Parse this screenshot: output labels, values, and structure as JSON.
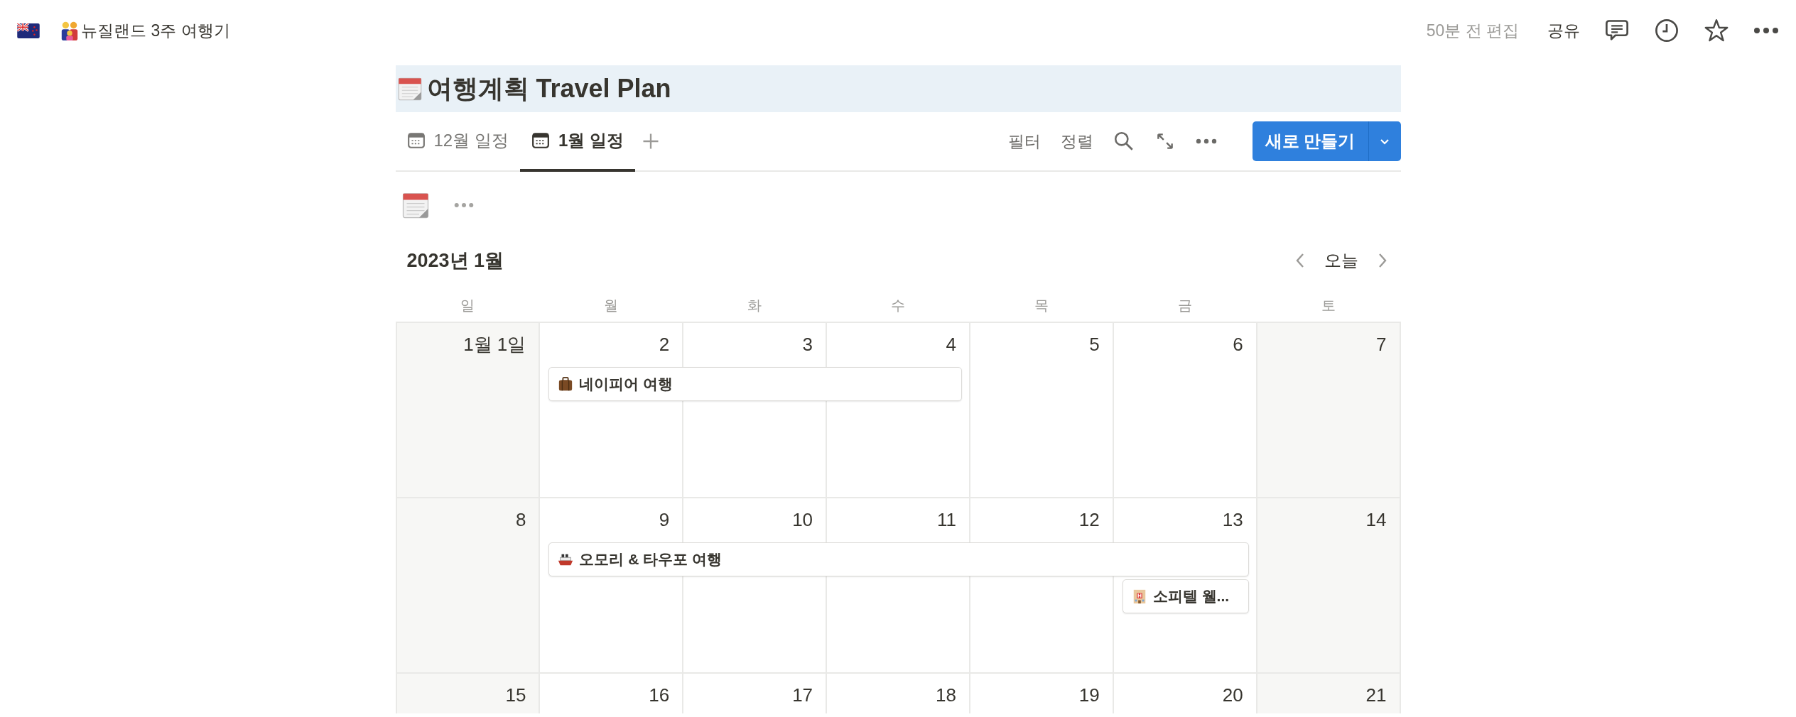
{
  "top_bar": {
    "breadcrumb": "뉴질랜드 3주 여행기",
    "edited": "50분 전 편집",
    "share": "공유"
  },
  "page": {
    "title": "여행계획 Travel Plan"
  },
  "tabs": [
    {
      "label": "12월 일정",
      "selected": false
    },
    {
      "label": "1월 일정",
      "selected": true
    }
  ],
  "toolbar": {
    "filter": "필터",
    "sort": "정렬",
    "new_button": "새로 만들기"
  },
  "calendar": {
    "month": "2023년 1월",
    "today": "오늘",
    "weekdays": [
      "일",
      "월",
      "화",
      "수",
      "목",
      "금",
      "토"
    ],
    "weeks": [
      {
        "days": [
          "1월 1일",
          "2",
          "3",
          "4",
          "5",
          "6",
          "7"
        ],
        "events": [
          {
            "title": "네이피어 여행",
            "kind": "luggage"
          }
        ]
      },
      {
        "days": [
          "8",
          "9",
          "10",
          "11",
          "12",
          "13",
          "14"
        ],
        "events": [
          {
            "title": "오모리 & 타우포 여행",
            "kind": "ship"
          },
          {
            "title": "소피텔 웰...",
            "kind": "hotel"
          }
        ]
      },
      {
        "days": [
          "15",
          "16",
          "17",
          "18",
          "19",
          "20",
          "21"
        ]
      }
    ]
  }
}
